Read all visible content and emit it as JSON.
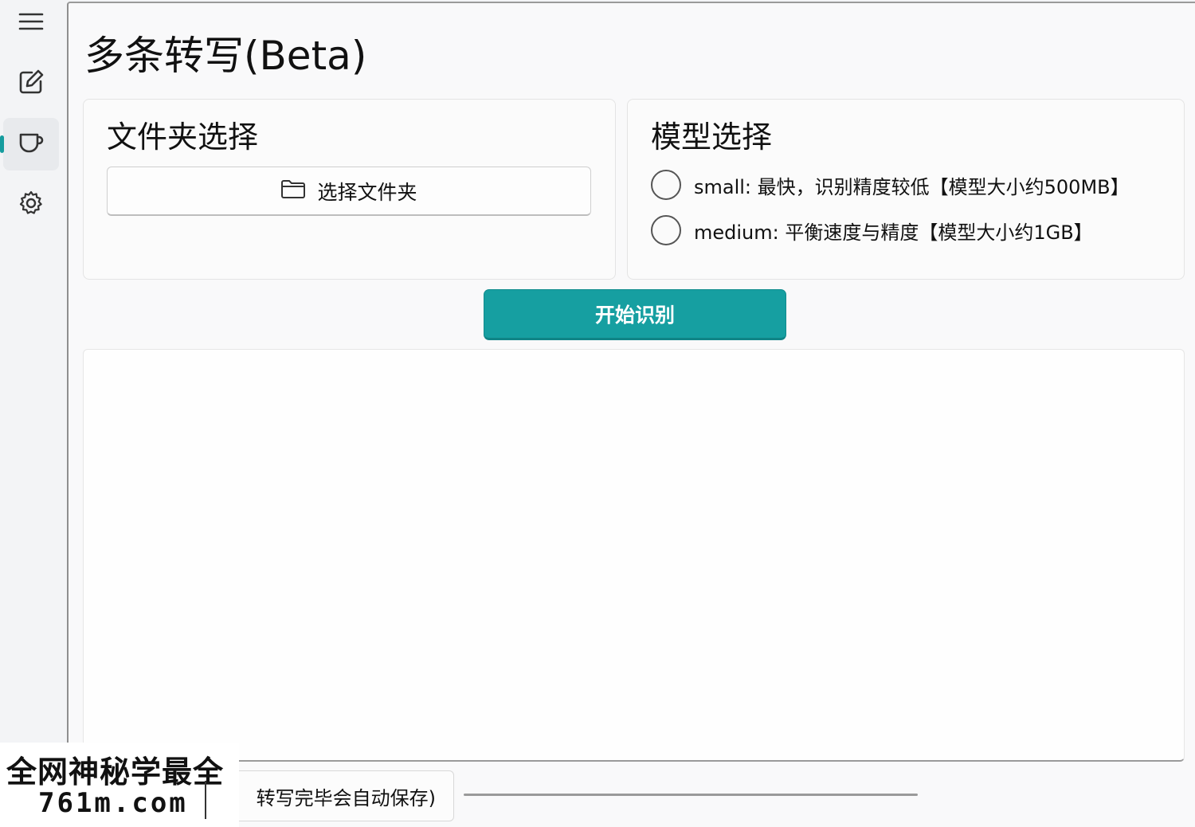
{
  "page": {
    "title": "多条转写(Beta)"
  },
  "sidebar": {
    "items": [
      {
        "icon": "hamburger-menu-icon"
      },
      {
        "icon": "edit-icon"
      },
      {
        "icon": "cup-icon",
        "active": true
      },
      {
        "icon": "gear-icon"
      }
    ]
  },
  "folder_card": {
    "title": "文件夹选择",
    "button_label": "选择文件夹",
    "button_icon": "folder-icon"
  },
  "model_card": {
    "title": "模型选择",
    "options": [
      {
        "label": "small: 最快，识别精度较低【模型大小约500MB】",
        "selected": false
      },
      {
        "label": "medium: 平衡速度与精度【模型大小约1GB】",
        "selected": false
      }
    ]
  },
  "actions": {
    "start_label": "开始识别",
    "bottom_button_label": "转写完毕会自动保存)"
  },
  "watermark": {
    "line1": "全网神秘学最全",
    "line2": "761m.com"
  },
  "colors": {
    "accent": "#169fa1"
  }
}
